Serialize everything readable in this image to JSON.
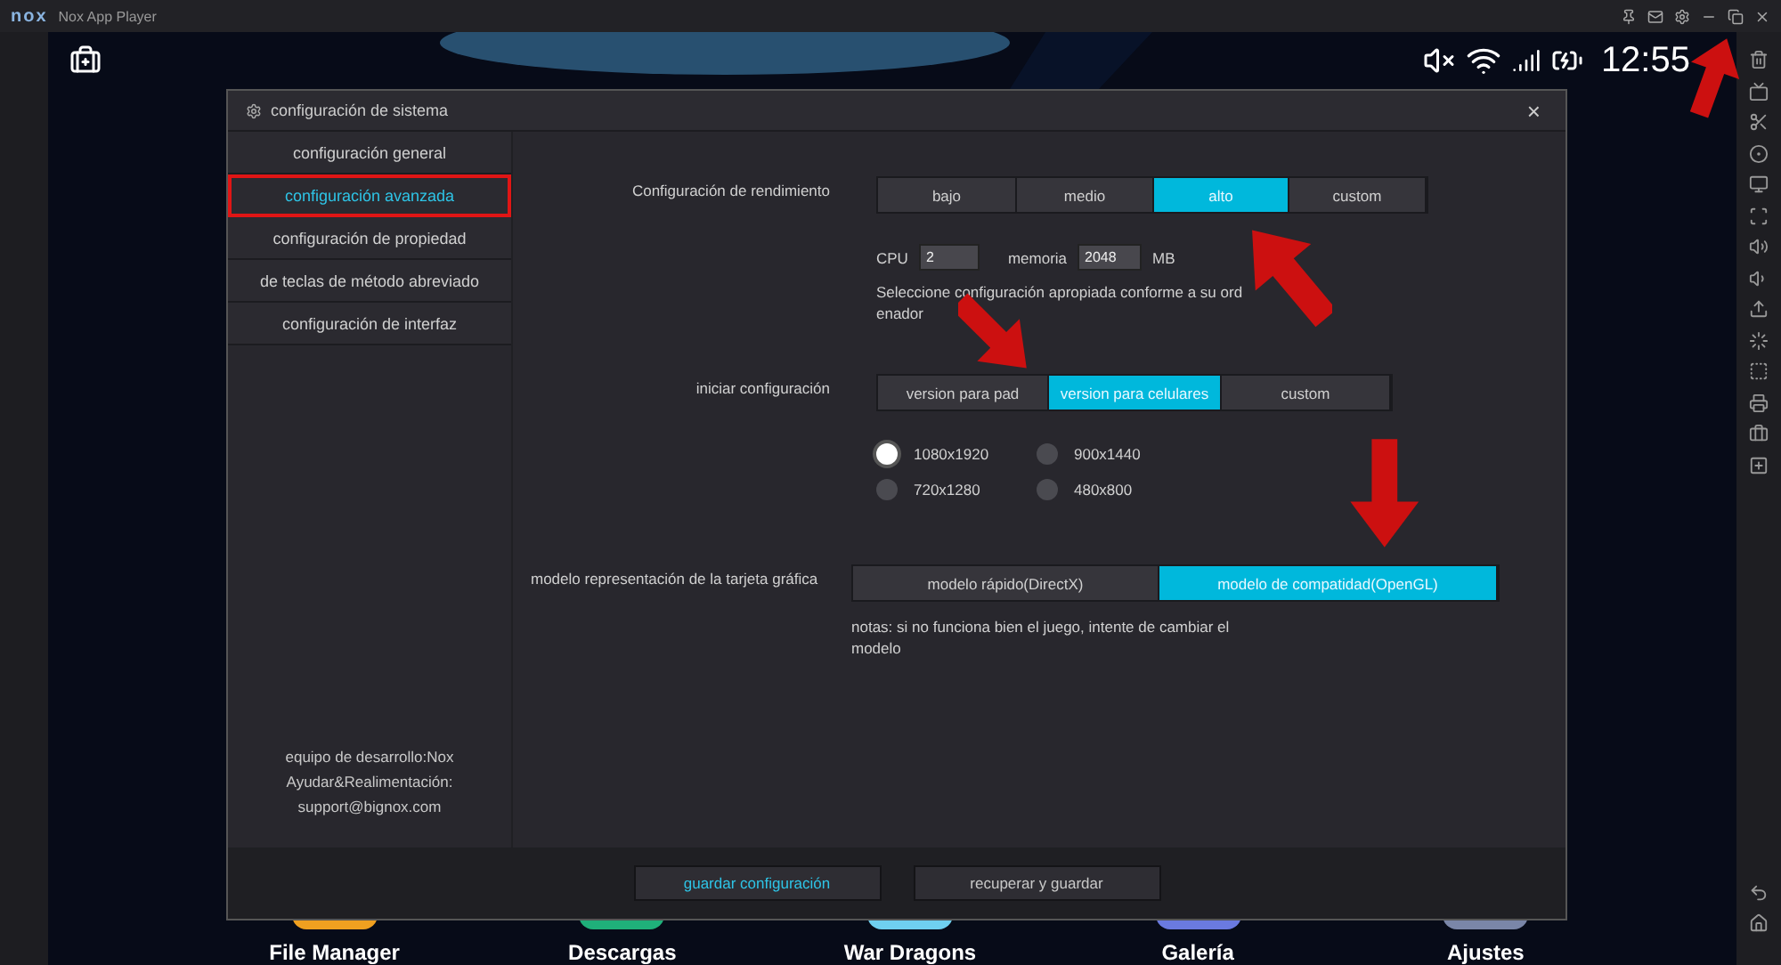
{
  "app": {
    "logo": "nox",
    "title": "Nox App Player"
  },
  "status_bar": {
    "time": "12:55"
  },
  "dialog": {
    "title": "configuración de sistema",
    "close": "×",
    "nav": [
      {
        "label": "configuración general",
        "selected": false
      },
      {
        "label": "configuración avanzada",
        "selected": true
      },
      {
        "label": "configuración de propiedad",
        "selected": false
      },
      {
        "label": "de teclas de método abreviado",
        "selected": false
      },
      {
        "label": "configuración de interfaz",
        "selected": false
      }
    ],
    "credits": [
      "equipo de desarrollo:Nox",
      "Ayudar&Realimentación:",
      "support@bignox.com"
    ],
    "performance": {
      "label": "Configuración de rendimiento",
      "options": [
        {
          "label": "bajo",
          "selected": false
        },
        {
          "label": "medio",
          "selected": false
        },
        {
          "label": "alto",
          "selected": true
        },
        {
          "label": "custom",
          "selected": false
        }
      ],
      "cpu": {
        "label": "CPU",
        "value": "2"
      },
      "memory": {
        "label": "memoria",
        "value": "2048",
        "unit": "MB"
      },
      "hint": "Seleccione configuración apropiada conforme a su ord enador"
    },
    "startup": {
      "label": "iniciar configuración",
      "options": [
        {
          "label": "version para pad",
          "selected": false
        },
        {
          "label": "version para celulares",
          "selected": true
        },
        {
          "label": "custom",
          "selected": false
        }
      ],
      "resolutions": [
        {
          "label": "1080x1920",
          "selected": true
        },
        {
          "label": "900x1440",
          "selected": false
        },
        {
          "label": "720x1280",
          "selected": false
        },
        {
          "label": "480x800",
          "selected": false
        }
      ]
    },
    "graphics": {
      "label": "modelo representación de la tarjeta gráfica",
      "options": [
        {
          "label": "modelo rápido(DirectX)",
          "selected": false
        },
        {
          "label": "modelo de compatidad(OpenGL)",
          "selected": true
        }
      ],
      "note": "notas: si no funciona bien el juego, intente de cambiar el modelo"
    },
    "buttons": [
      {
        "label": "guardar configuración",
        "highlighted": true
      },
      {
        "label": "recuperar y guardar",
        "highlighted": false
      }
    ]
  },
  "dock": [
    {
      "label": "File Manager",
      "color": "#f0a020"
    },
    {
      "label": "Descargas",
      "color": "#1fb07a"
    },
    {
      "label": "War Dragons",
      "color": "#6fd0f0"
    },
    {
      "label": "Galería",
      "color": "#6a7ae0"
    },
    {
      "label": "Ajustes",
      "color": "#7a86a8"
    }
  ]
}
